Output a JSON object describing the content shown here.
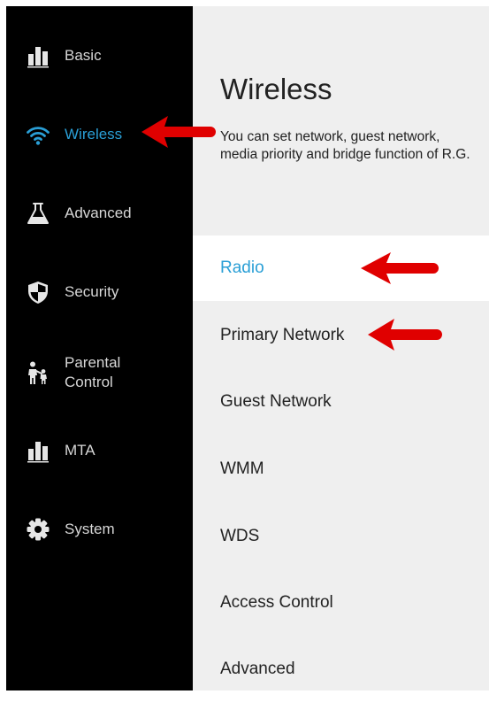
{
  "colors": {
    "sidebar_bg": "#000000",
    "content_bg": "#efefef",
    "active_blue": "#2a9fd6",
    "annotation_red": "#e00000"
  },
  "sidebar": {
    "items": [
      {
        "label": "Basic",
        "icon": "bar-chart-icon",
        "active": false
      },
      {
        "label": "Wireless",
        "icon": "wifi-icon",
        "active": true
      },
      {
        "label": "Advanced",
        "icon": "flask-icon",
        "active": false
      },
      {
        "label": "Security",
        "icon": "shield-icon",
        "active": false
      },
      {
        "label": "Parental Control",
        "icon": "family-icon",
        "active": false
      },
      {
        "label": "MTA",
        "icon": "bar-chart-icon",
        "active": false
      },
      {
        "label": "System",
        "icon": "gear-icon",
        "active": false
      }
    ]
  },
  "main": {
    "title": "Wireless",
    "description": "You can set network, guest network, media priority and bridge function of R.G.",
    "submenu": [
      {
        "label": "Radio",
        "active": true
      },
      {
        "label": "Primary Network",
        "active": false
      },
      {
        "label": "Guest Network",
        "active": false
      },
      {
        "label": "WMM",
        "active": false
      },
      {
        "label": "WDS",
        "active": false
      },
      {
        "label": "Access Control",
        "active": false
      },
      {
        "label": "Advanced",
        "active": false
      }
    ]
  },
  "annotations": {
    "arrows": [
      "wireless-nav",
      "radio-submenu",
      "primary-network-submenu"
    ]
  }
}
